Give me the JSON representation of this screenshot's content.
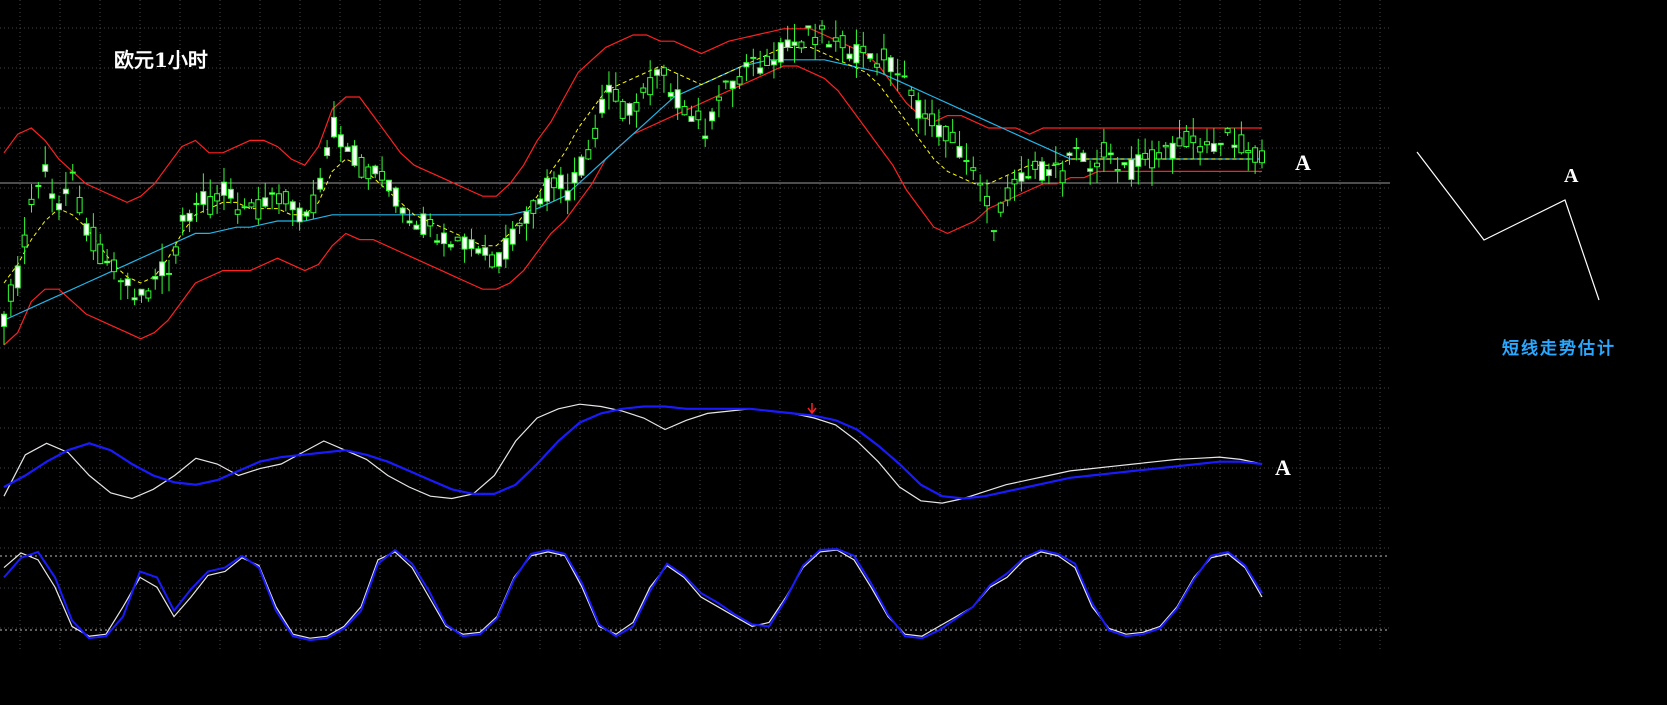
{
  "chart_title": "欧元1小时",
  "forecast_label": "短线走势估计",
  "marker_main": "A",
  "marker_osc": "A",
  "marker_forecast": "A",
  "colors": {
    "background": "#000000",
    "grid": "#5a5a5a",
    "candle_bull_body": "#ffffff",
    "candle_outline": "#33ff33",
    "bollinger": "#ff2020",
    "ma_slow": "#22b4e8",
    "ma_fast": "#ffff00",
    "osc_fast": "#e6e6e6",
    "osc_slow": "#1a1aff",
    "signal_arrow": "#ff2020",
    "forecast_line": "#ffffff",
    "forecast_text": "#2aa8ff"
  },
  "chart_data": [
    {
      "type": "candlestick",
      "title": "欧元1小时",
      "note": "EUR hourly candles with Bollinger bands, slow MA and dashed fast MA; relative price scale (0=low, 100=high)",
      "close_path": [
        10,
        22,
        48,
        55,
        45,
        52,
        38,
        30,
        24,
        18,
        14,
        20,
        26,
        40,
        48,
        44,
        50,
        46,
        42,
        45,
        48,
        44,
        40,
        52,
        70,
        64,
        58,
        56,
        50,
        44,
        40,
        38,
        36,
        34,
        32,
        30,
        28,
        35,
        42,
        48,
        52,
        50,
        58,
        70,
        82,
        76,
        78,
        84,
        86,
        80,
        74,
        70,
        80,
        84,
        88,
        90,
        94,
        96,
        98,
        100,
        98,
        96,
        95,
        94,
        92,
        88,
        80,
        74,
        70,
        66,
        60,
        50,
        40,
        48,
        52,
        56,
        58,
        56,
        60,
        58,
        62,
        60,
        56,
        60,
        62,
        64,
        66,
        64,
        65,
        66,
        64,
        62,
        58
      ],
      "bollinger_upper": [
        62,
        68,
        70,
        66,
        60,
        56,
        52,
        50,
        48,
        46,
        48,
        52,
        58,
        64,
        66,
        62,
        62,
        64,
        66,
        66,
        64,
        60,
        58,
        64,
        76,
        80,
        80,
        74,
        68,
        62,
        58,
        56,
        54,
        52,
        50,
        48,
        48,
        52,
        58,
        66,
        72,
        80,
        88,
        92,
        96,
        98,
        100,
        100,
        98,
        98,
        96,
        94,
        96,
        98,
        99,
        100,
        101,
        102,
        102,
        102,
        100,
        98,
        96,
        94,
        90,
        84,
        78,
        74,
        72,
        74,
        74,
        72,
        70,
        70,
        70,
        68,
        70,
        70,
        70,
        70,
        70,
        70,
        70,
        70,
        70,
        70,
        70,
        70,
        70,
        70,
        70,
        70,
        70
      ],
      "bollinger_lower": [
        0,
        4,
        14,
        18,
        18,
        14,
        10,
        8,
        6,
        4,
        2,
        4,
        8,
        14,
        20,
        22,
        24,
        24,
        24,
        26,
        28,
        26,
        24,
        26,
        32,
        36,
        34,
        34,
        32,
        30,
        28,
        26,
        24,
        22,
        20,
        18,
        18,
        20,
        24,
        30,
        36,
        40,
        46,
        52,
        60,
        64,
        68,
        70,
        72,
        74,
        76,
        78,
        80,
        82,
        84,
        86,
        88,
        90,
        90,
        88,
        86,
        82,
        76,
        70,
        64,
        58,
        50,
        44,
        38,
        36,
        38,
        40,
        44,
        46,
        48,
        50,
        52,
        52,
        54,
        54,
        56,
        56,
        56,
        56,
        56,
        56,
        56,
        56,
        56,
        56,
        56,
        56,
        56
      ],
      "ma_slow": [
        8,
        10,
        12,
        14,
        16,
        18,
        20,
        22,
        24,
        26,
        28,
        30,
        32,
        34,
        36,
        36,
        37,
        38,
        38,
        39,
        40,
        40,
        40,
        41,
        42,
        42,
        42,
        42,
        42,
        42,
        42,
        42,
        42,
        42,
        42,
        42,
        42,
        42,
        43,
        44,
        46,
        48,
        52,
        56,
        60,
        64,
        68,
        72,
        76,
        80,
        82,
        84,
        86,
        88,
        90,
        91,
        92,
        92,
        92,
        92,
        92,
        91,
        90,
        89,
        88,
        86,
        84,
        82,
        80,
        78,
        76,
        74,
        72,
        70,
        68,
        66,
        64,
        62,
        60,
        60,
        60,
        60,
        60,
        60,
        60,
        60,
        60,
        60,
        60,
        60,
        60,
        60,
        60
      ],
      "ma_fast": [
        20,
        26,
        34,
        40,
        44,
        42,
        38,
        32,
        26,
        22,
        20,
        22,
        28,
        36,
        42,
        44,
        46,
        46,
        44,
        44,
        44,
        42,
        42,
        46,
        56,
        60,
        58,
        54,
        50,
        46,
        42,
        40,
        38,
        36,
        34,
        32,
        32,
        36,
        42,
        48,
        56,
        62,
        70,
        76,
        82,
        84,
        86,
        88,
        90,
        88,
        86,
        84,
        86,
        88,
        90,
        92,
        94,
        96,
        96,
        96,
        94,
        92,
        90,
        88,
        84,
        78,
        72,
        66,
        60,
        56,
        54,
        52,
        52,
        54,
        56,
        58,
        58,
        58,
        60,
        60,
        60,
        60,
        60,
        60,
        60,
        60,
        60,
        60,
        60,
        60,
        60,
        60,
        60
      ]
    },
    {
      "type": "line",
      "note": "Upper oscillator (two moving lines)",
      "series": [
        {
          "values": [
            12,
            48,
            58,
            50,
            30,
            15,
            10,
            18,
            30,
            45,
            40,
            30,
            36,
            40,
            50,
            60,
            52,
            44,
            30,
            20,
            12,
            10,
            14,
            30,
            60,
            80,
            88,
            92,
            90,
            86,
            80,
            70,
            78,
            84,
            86,
            88,
            86,
            84,
            80,
            74,
            60,
            42,
            20,
            8,
            6,
            10,
            16,
            22,
            26,
            30,
            34,
            36,
            38,
            40,
            42,
            44,
            45,
            46,
            44,
            40
          ]
        },
        {
          "values": [
            20,
            30,
            42,
            52,
            58,
            52,
            40,
            30,
            24,
            22,
            26,
            34,
            42,
            46,
            48,
            50,
            52,
            48,
            42,
            34,
            26,
            18,
            14,
            14,
            22,
            40,
            60,
            76,
            84,
            88,
            90,
            90,
            88,
            88,
            88,
            88,
            86,
            84,
            82,
            78,
            70,
            56,
            40,
            22,
            12,
            10,
            12,
            16,
            20,
            24,
            28,
            30,
            32,
            34,
            36,
            38,
            40,
            42,
            42,
            40
          ]
        }
      ]
    },
    {
      "type": "line",
      "note": "Lower stochastic-style oscillator with upper and lower dashed levels",
      "series": [
        {
          "values": [
            80,
            95,
            88,
            60,
            20,
            10,
            12,
            40,
            70,
            60,
            30,
            50,
            72,
            76,
            90,
            82,
            40,
            12,
            8,
            10,
            20,
            40,
            88,
            96,
            80,
            50,
            20,
            12,
            14,
            30,
            70,
            92,
            96,
            92,
            60,
            20,
            12,
            24,
            60,
            82,
            70,
            50,
            40,
            30,
            20,
            24,
            50,
            80,
            96,
            98,
            88,
            60,
            30,
            12,
            10,
            20,
            30,
            40,
            60,
            70,
            88,
            96,
            92,
            80,
            40,
            18,
            12,
            14,
            20,
            40,
            70,
            90,
            94,
            80,
            50
          ]
        },
        {
          "values": [
            70,
            90,
            96,
            70,
            26,
            8,
            10,
            30,
            76,
            70,
            36,
            58,
            76,
            80,
            92,
            80,
            36,
            10,
            6,
            8,
            18,
            36,
            84,
            98,
            84,
            56,
            22,
            10,
            12,
            28,
            68,
            94,
            98,
            94,
            64,
            22,
            10,
            20,
            56,
            84,
            72,
            54,
            44,
            32,
            22,
            20,
            48,
            82,
            98,
            99,
            92,
            64,
            32,
            10,
            8,
            16,
            28,
            40,
            62,
            74,
            90,
            98,
            94,
            84,
            44,
            16,
            10,
            12,
            18,
            38,
            68,
            92,
            96,
            82,
            54
          ]
        }
      ]
    }
  ]
}
